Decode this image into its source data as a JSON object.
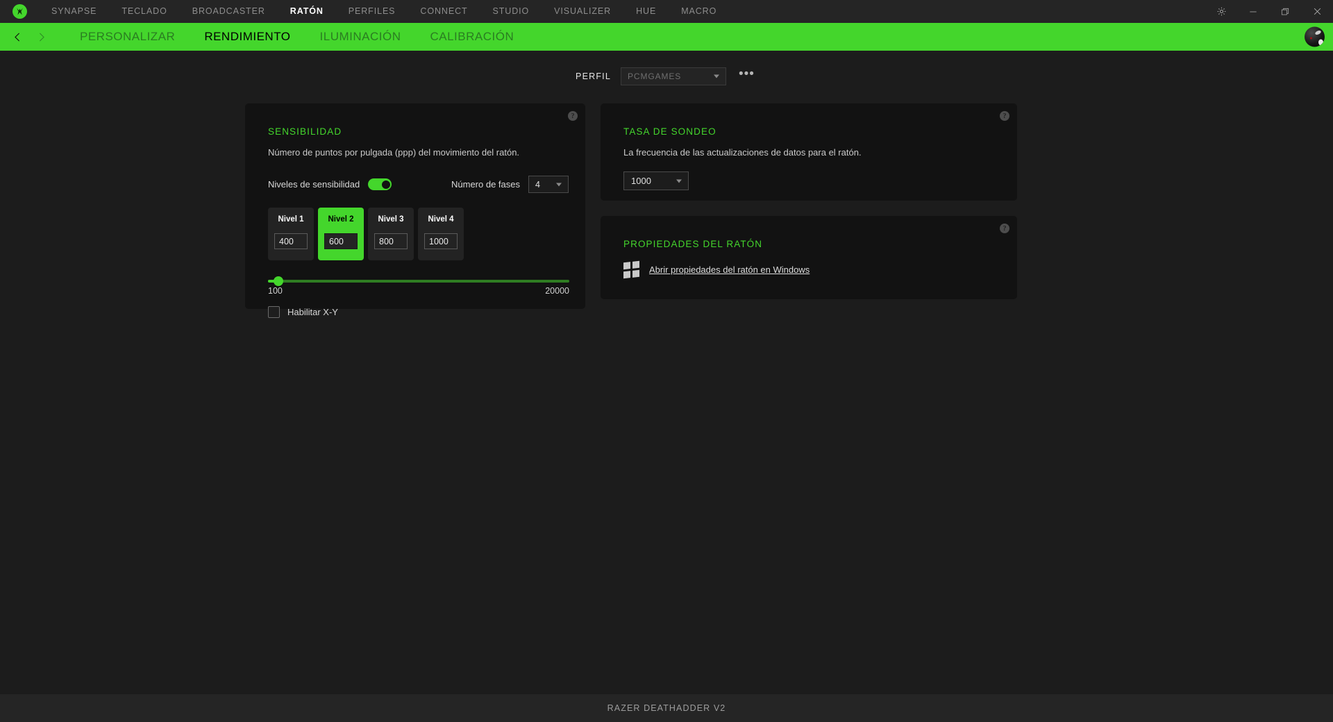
{
  "titlebar": {
    "logo_icon": "razer-logo-icon",
    "tabs": [
      {
        "label": "SYNAPSE",
        "active": false
      },
      {
        "label": "TECLADO",
        "active": false
      },
      {
        "label": "BROADCASTER",
        "active": false
      },
      {
        "label": "RATÓN",
        "active": true
      },
      {
        "label": "PERFILES",
        "active": false
      },
      {
        "label": "CONNECT",
        "active": false
      },
      {
        "label": "STUDIO",
        "active": false
      },
      {
        "label": "VISUALIZER",
        "active": false
      },
      {
        "label": "HUE",
        "active": false
      },
      {
        "label": "MACRO",
        "active": false
      }
    ],
    "window_controls": [
      {
        "name": "settings-gear-icon"
      },
      {
        "name": "minimize-icon"
      },
      {
        "name": "restore-icon"
      },
      {
        "name": "close-icon"
      }
    ]
  },
  "subnav": {
    "back_icon": "chevron-left-icon",
    "forward_icon": "chevron-right-icon",
    "tabs": [
      {
        "label": "PERSONALIZAR",
        "active": false
      },
      {
        "label": "RENDIMIENTO",
        "active": true
      },
      {
        "label": "ILUMINACIÓN",
        "active": false
      },
      {
        "label": "CALIBRACIÓN",
        "active": false
      }
    ],
    "avatar": "user-avatar"
  },
  "profile": {
    "label": "PERFIL",
    "selected": "PCMGAMES",
    "more_label": "•••"
  },
  "sensitivity": {
    "title": "SENSIBILIDAD",
    "description": "Número de puntos por pulgada (ppp) del movimiento del ratón.",
    "toggle_label": "Niveles de sensibilidad",
    "toggle_on": true,
    "phases_label": "Número de fases",
    "phases_value": "4",
    "levels": [
      {
        "name": "Nivel 1",
        "value": "400",
        "selected": false
      },
      {
        "name": "Nivel 2",
        "value": "600",
        "selected": true
      },
      {
        "name": "Nivel 3",
        "value": "800",
        "selected": false
      },
      {
        "name": "Nivel 4",
        "value": "1000",
        "selected": false
      }
    ],
    "slider": {
      "min": "100",
      "max": "20000",
      "value": 600,
      "percent": 3.5
    },
    "checkbox_label": "Habilitar X-Y",
    "checkbox_checked": false,
    "help_glyph": "?"
  },
  "polling": {
    "title": "TASA DE SONDEO",
    "description": "La frecuencia de las actualizaciones de datos para el ratón.",
    "value": "1000",
    "help_glyph": "?"
  },
  "mouse_properties": {
    "title": "PROPIEDADES DEL RATÓN",
    "link_label": "Abrir propiedades del ratón en Windows",
    "icon": "windows-logo-icon",
    "help_glyph": "?"
  },
  "footer": {
    "device": "RAZER DEATHADDER V2"
  },
  "colors": {
    "accent": "#44d62c",
    "titlebar_bg": "#252525",
    "page_bg": "#1c1c1c",
    "card_bg": "#121212"
  }
}
